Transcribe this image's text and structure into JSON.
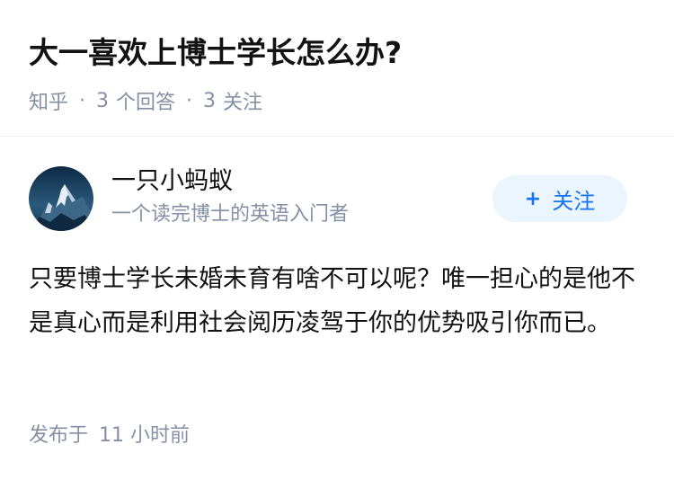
{
  "question": {
    "title": "大一喜欢上博士学长怎么办?",
    "source": "知乎",
    "answer_count": "3",
    "answer_label": "个回答",
    "follow_count": "3",
    "follow_label": "关注",
    "separator": "·"
  },
  "author": {
    "name": "一只小蚂蚁",
    "bio": "一个读完博士的英语入门者",
    "avatar_icon": "mountain-avatar-icon",
    "follow_button_label": "关注",
    "follow_button_icon": "+"
  },
  "answer": {
    "content": "只要博士学长未婚未育有啥不可以呢？唯一担心的是他不是真心而是利用社会阅历凌驾于你的优势吸引你而已。",
    "published_label": "发布于",
    "published_time": "11 小时前"
  },
  "colors": {
    "text_primary": "#121212",
    "text_secondary": "#8590a6",
    "accent": "#1772f6",
    "button_bg": "#ebf5fd",
    "divider": "#f0f0f0"
  }
}
